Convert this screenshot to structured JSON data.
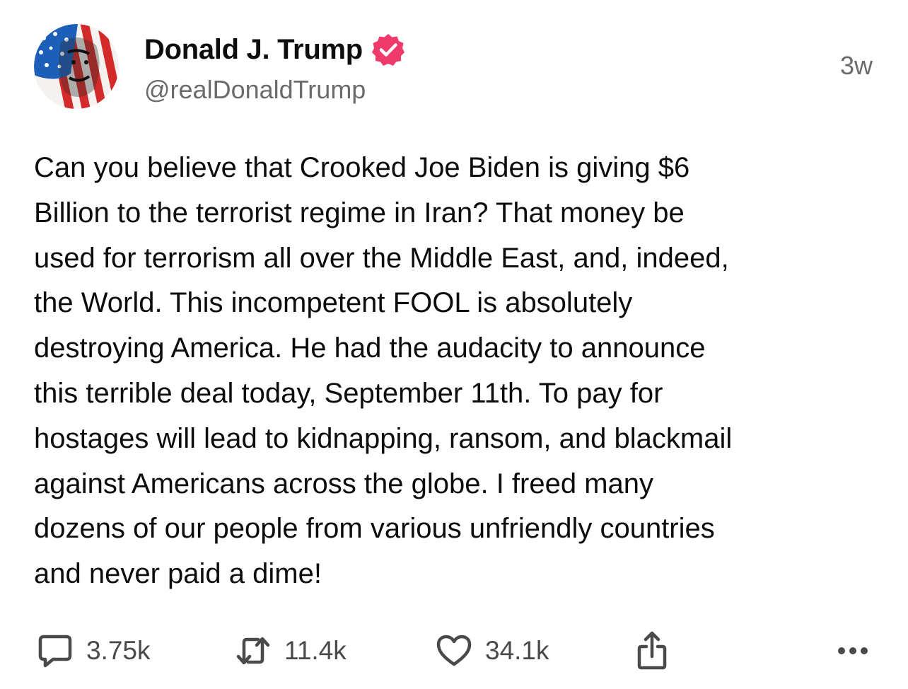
{
  "post": {
    "author": {
      "display_name": "Donald J. Trump",
      "handle": "@realDonaldTrump",
      "avatar_icon": "flag-portrait-avatar",
      "verified_icon": "verified-badge-icon",
      "verified_color": "#f03a6c"
    },
    "timestamp": "3w",
    "text": "Can you believe that Crooked Joe Biden is giving $6\nBillion to the terrorist regime in Iran? That money be\nused for terrorism all over the Middle East, and, indeed,\nthe World. This incompetent FOOL is absolutely\ndestroying America. He had the audacity to announce\nthis terrible deal today, September 11th. To pay for\nhostages will lead to kidnapping, ransom, and blackmail\nagainst Americans across the globe. I freed many\ndozens of our people from various unfriendly countries\nand never paid a dime!"
  },
  "actions": {
    "reply": {
      "icon": "reply-icon",
      "count": "3.75k"
    },
    "repost": {
      "icon": "repost-icon",
      "count": "11.4k"
    },
    "like": {
      "icon": "heart-icon",
      "count": "34.1k"
    },
    "share": {
      "icon": "share-icon"
    },
    "more": {
      "icon": "more-icon"
    }
  },
  "colors": {
    "text": "#0d0d0d",
    "secondary_text": "#6b6b6b",
    "icon": "#4a4a4a",
    "background": "#ffffff"
  }
}
